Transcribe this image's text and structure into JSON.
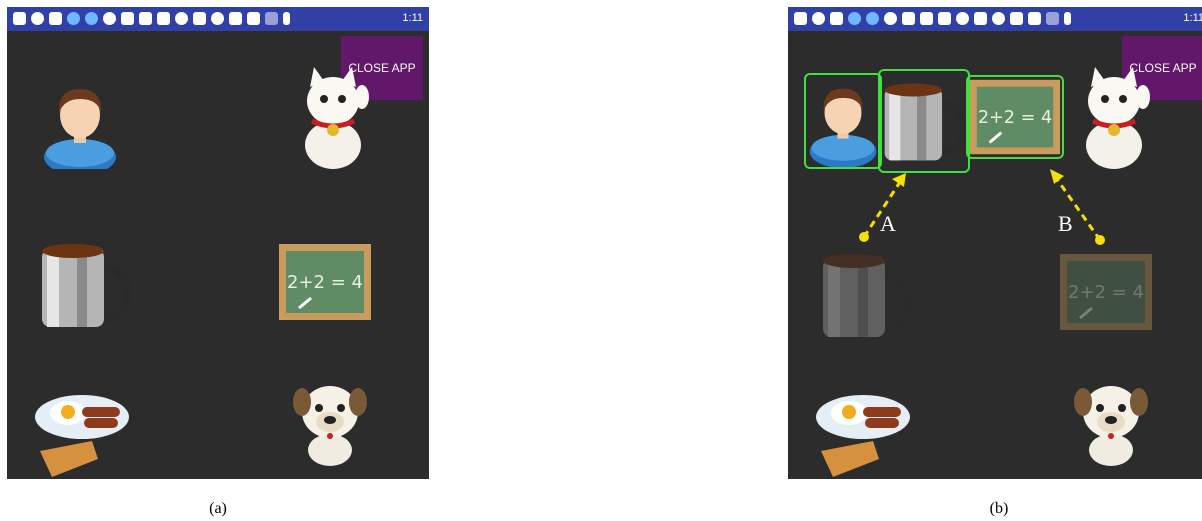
{
  "panels": [
    {
      "caption": "(a)",
      "statusbar": {
        "time": "1:11"
      },
      "close_button": {
        "label": "CLOSE APP"
      },
      "icons": [
        "person-icon",
        "lucky-cat-icon",
        "coffee-mug-icon",
        "chalkboard-icon",
        "breakfast-plate-icon",
        "dog-icon"
      ]
    },
    {
      "caption": "(b)",
      "statusbar": {
        "time": "1:11"
      },
      "close_button": {
        "label": "CLOSE APP"
      },
      "sentence_icons": [
        "person-icon",
        "coffee-mug-icon",
        "chalkboard-icon"
      ],
      "arrows": [
        {
          "label": "A"
        },
        {
          "label": "B"
        }
      ],
      "chalkboard_text": "2+2 = 4"
    }
  ],
  "colors": {
    "status_bar": "#3140a6",
    "screen_bg": "#2c2c2c",
    "close_button": "#62176a",
    "highlight": "#3fe03f",
    "arrow": "#f5e000"
  }
}
